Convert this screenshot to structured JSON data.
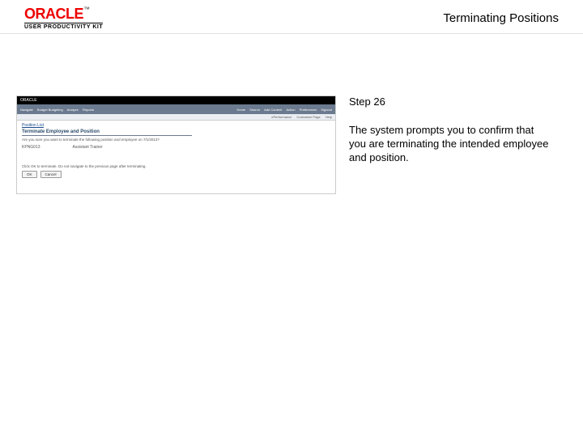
{
  "header": {
    "brand": "ORACLE",
    "tm": "™",
    "product_line": "USER PRODUCTIVITY KIT",
    "title": "Terminating Positions"
  },
  "instructions": {
    "step_label": "Step 26",
    "description": "The system prompts you to confirm that you are terminating the intended employee and position."
  },
  "thumb": {
    "topbar": "ORACLE",
    "nav_left": [
      "Navigate",
      "Budget Budgeting",
      "Analyze",
      "Reports"
    ],
    "nav_right": [
      "Home",
      "Search",
      "Add Content",
      "Action",
      "Preferences",
      "Signout"
    ],
    "subbar": [
      "ePerformance",
      "Customize Page",
      "Help"
    ],
    "breadcrumb": "Position List",
    "page_heading": "Terminate Employee and Position",
    "confirm_text": "Are you sure you want to terminate the following position and employee on 7/1/2013?",
    "col1": "KPNG013",
    "col2": "Assistant Trainer",
    "note": "Click OK to terminate. Do not navigate to the previous page after terminating.",
    "btn_ok": "OK",
    "btn_cancel": "Cancel"
  }
}
